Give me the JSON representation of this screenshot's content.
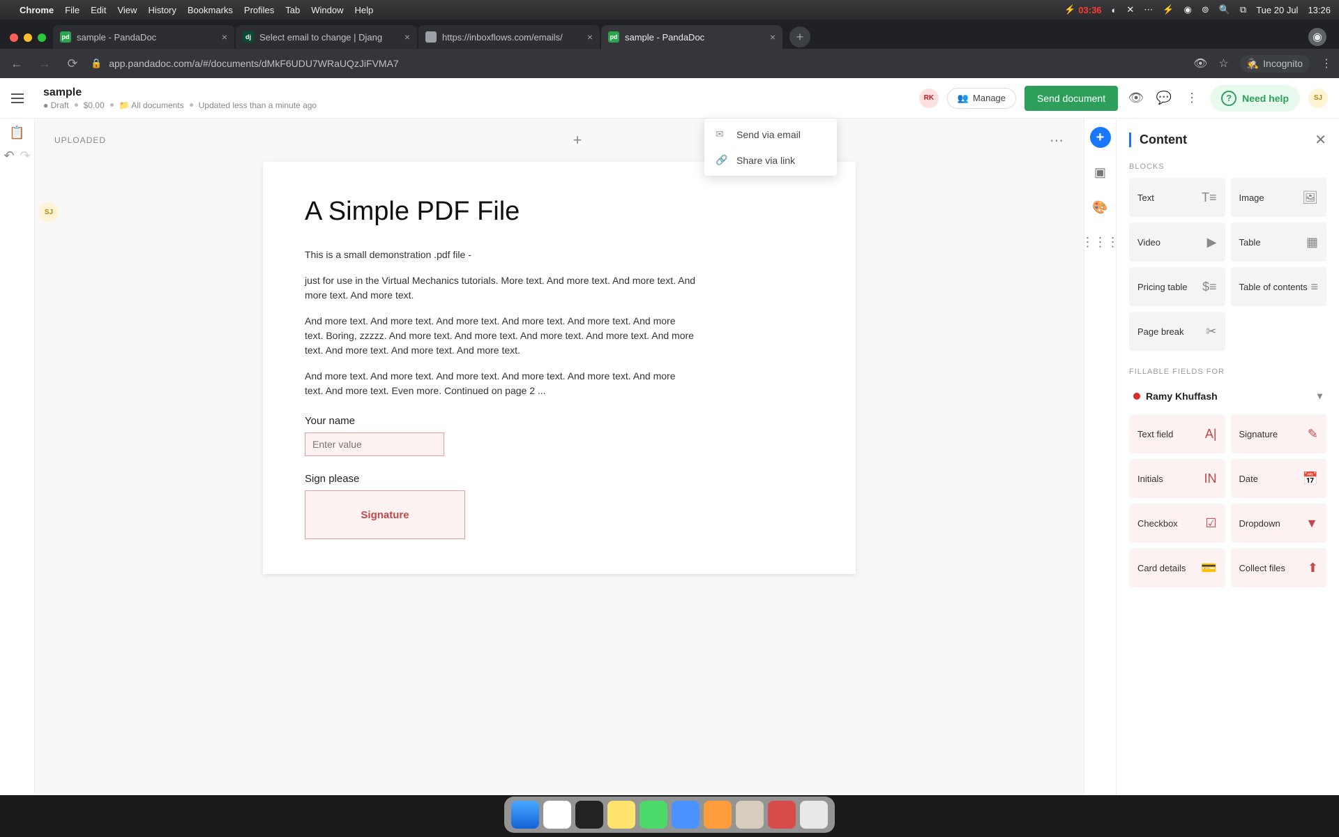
{
  "menubar": {
    "app": "Chrome",
    "items": [
      "File",
      "Edit",
      "View",
      "History",
      "Bookmarks",
      "Profiles",
      "Tab",
      "Window",
      "Help"
    ],
    "battery": "03:36",
    "date": "Tue 20 Jul",
    "time": "13:26"
  },
  "tabs": [
    {
      "title": "sample - PandaDoc",
      "favicon": "pd"
    },
    {
      "title": "Select email to change | Djang",
      "favicon": "dj"
    },
    {
      "title": "https://inboxflows.com/emails/",
      "favicon": "bl"
    },
    {
      "title": "sample - PandaDoc",
      "favicon": "pd",
      "active": true
    }
  ],
  "address": "app.pandadoc.com/a/#/documents/dMkF6UDU7WRaUQzJiFVMA7",
  "incognito_label": "Incognito",
  "doc": {
    "title": "sample",
    "status": "Draft",
    "price": "$0.00",
    "folder": "All documents",
    "updated": "Updated less than a minute ago"
  },
  "header": {
    "avatar1": "RK",
    "manage": "Manage",
    "send": "Send document",
    "help": "Need help",
    "avatar2": "SJ"
  },
  "send_menu": {
    "email": "Send via email",
    "link": "Share via link"
  },
  "canvas": {
    "section": "UPLOADED",
    "h1": "A Simple PDF File",
    "p1": "This is a small demonstration .pdf file -",
    "p2": "just for use in the Virtual Mechanics tutorials. More text. And more text. And more text. And more text. And more text.",
    "p3": "And more text. And more text. And more text. And more text. And more text. And more text. Boring, zzzzz. And more text. And more text. And more text. And more text. And more text. And more text. And more text. And more text.",
    "p4": "And more text. And more text. And more text. And more text. And more text. And more text. And more text. Even more. Continued on page 2 ...",
    "name_label": "Your name",
    "name_placeholder": "Enter value",
    "sig_label": "Sign please",
    "sig_text": "Signature"
  },
  "panel": {
    "title": "Content",
    "blocks_label": "BLOCKS",
    "blocks": {
      "text": "Text",
      "image": "Image",
      "video": "Video",
      "table": "Table",
      "pricing": "Pricing table",
      "toc": "Table of contents",
      "pagebreak": "Page break"
    },
    "fields_label": "FILLABLE FIELDS FOR",
    "assignee": "Ramy Khuffash",
    "fields": {
      "text": "Text field",
      "signature": "Signature",
      "initials": "Initials",
      "date": "Date",
      "checkbox": "Checkbox",
      "dropdown": "Dropdown",
      "card": "Card details",
      "collect": "Collect files"
    }
  }
}
